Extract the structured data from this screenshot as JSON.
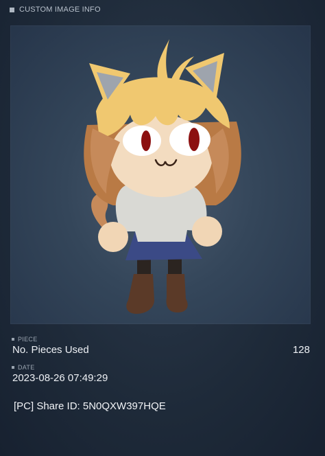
{
  "header": {
    "title": "CUSTOM IMAGE INFO"
  },
  "image": {
    "subject": "chibi cat-eared character illustration"
  },
  "piece": {
    "label": "PIECE",
    "name": "No. Pieces Used",
    "count": "128"
  },
  "date": {
    "label": "DATE",
    "value": "2023-08-26 07:49:29"
  },
  "share": {
    "text": "[PC] Share ID: 5N0QXW397HQE"
  }
}
